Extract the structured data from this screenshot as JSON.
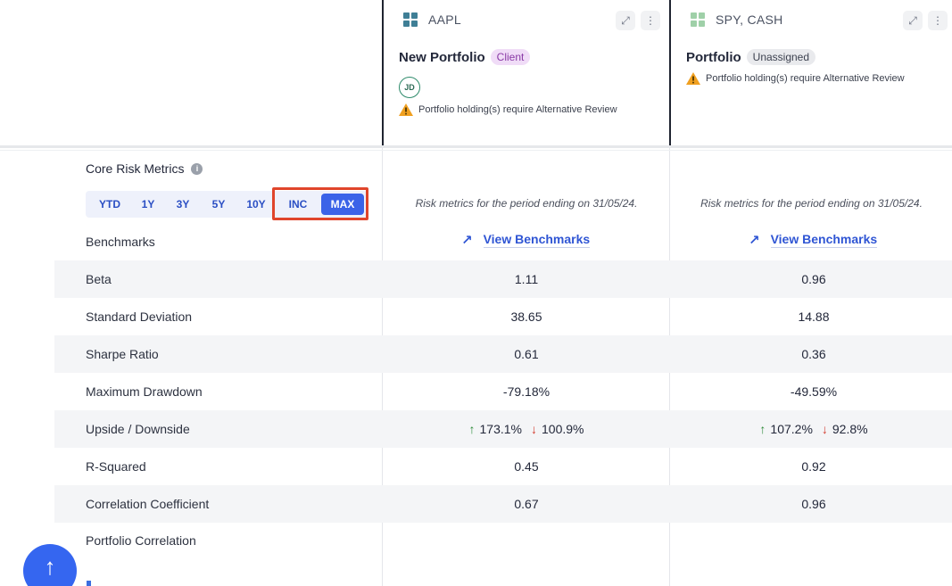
{
  "columns": [
    {
      "ticker": "AAPL",
      "portfolio_name": "New Portfolio",
      "badge": "Client",
      "avatar_initials": "JD",
      "warning": "Portfolio holding(s) require Alternative Review",
      "period_note": "Risk metrics for the period ending on 31/05/24.",
      "benchmarks_link": "View Benchmarks"
    },
    {
      "ticker": "SPY, CASH",
      "portfolio_name": "Portfolio",
      "badge": "Unassigned",
      "warning": "Portfolio holding(s) require Alternative Review",
      "period_note": "Risk metrics for the period ending on 31/05/24.",
      "benchmarks_link": "View Benchmarks"
    }
  ],
  "section": {
    "title": "Core Risk Metrics",
    "info_icon": "i"
  },
  "periods": [
    "YTD",
    "1Y",
    "3Y",
    "5Y",
    "10Y",
    "INC",
    "MAX"
  ],
  "active_period": "MAX",
  "metrics": {
    "benchmarks": "Benchmarks",
    "beta": {
      "label": "Beta",
      "v1": "1.11",
      "v2": "0.96"
    },
    "std_dev": {
      "label": "Standard Deviation",
      "v1": "38.65",
      "v2": "14.88"
    },
    "sharpe": {
      "label": "Sharpe Ratio",
      "v1": "0.61",
      "v2": "0.36"
    },
    "max_dd": {
      "label": "Maximum Drawdown",
      "v1": "-79.18%",
      "v2": "-49.59%"
    },
    "updown": {
      "label": "Upside / Downside",
      "up1": "173.1%",
      "down1": "100.9%",
      "up2": "107.2%",
      "down2": "92.8%"
    },
    "r2": {
      "label": "R-Squared",
      "v1": "0.45",
      "v2": "0.92"
    },
    "corr": {
      "label": "Correlation Coefficient",
      "v1": "0.67",
      "v2": "0.96"
    },
    "port_corr": "Portfolio Correlation"
  },
  "icons": {
    "up_arrow": "↑",
    "down_arrow": "↓",
    "link_arrow": "↗",
    "expand": "⤢",
    "more": "⋮",
    "scroll_top": "↑"
  },
  "colors": {
    "accent": "#3b63e8",
    "highlight": "#e0452b",
    "aapl_icon": "#3f7f96",
    "spy_icon": "#9fd0a8"
  }
}
